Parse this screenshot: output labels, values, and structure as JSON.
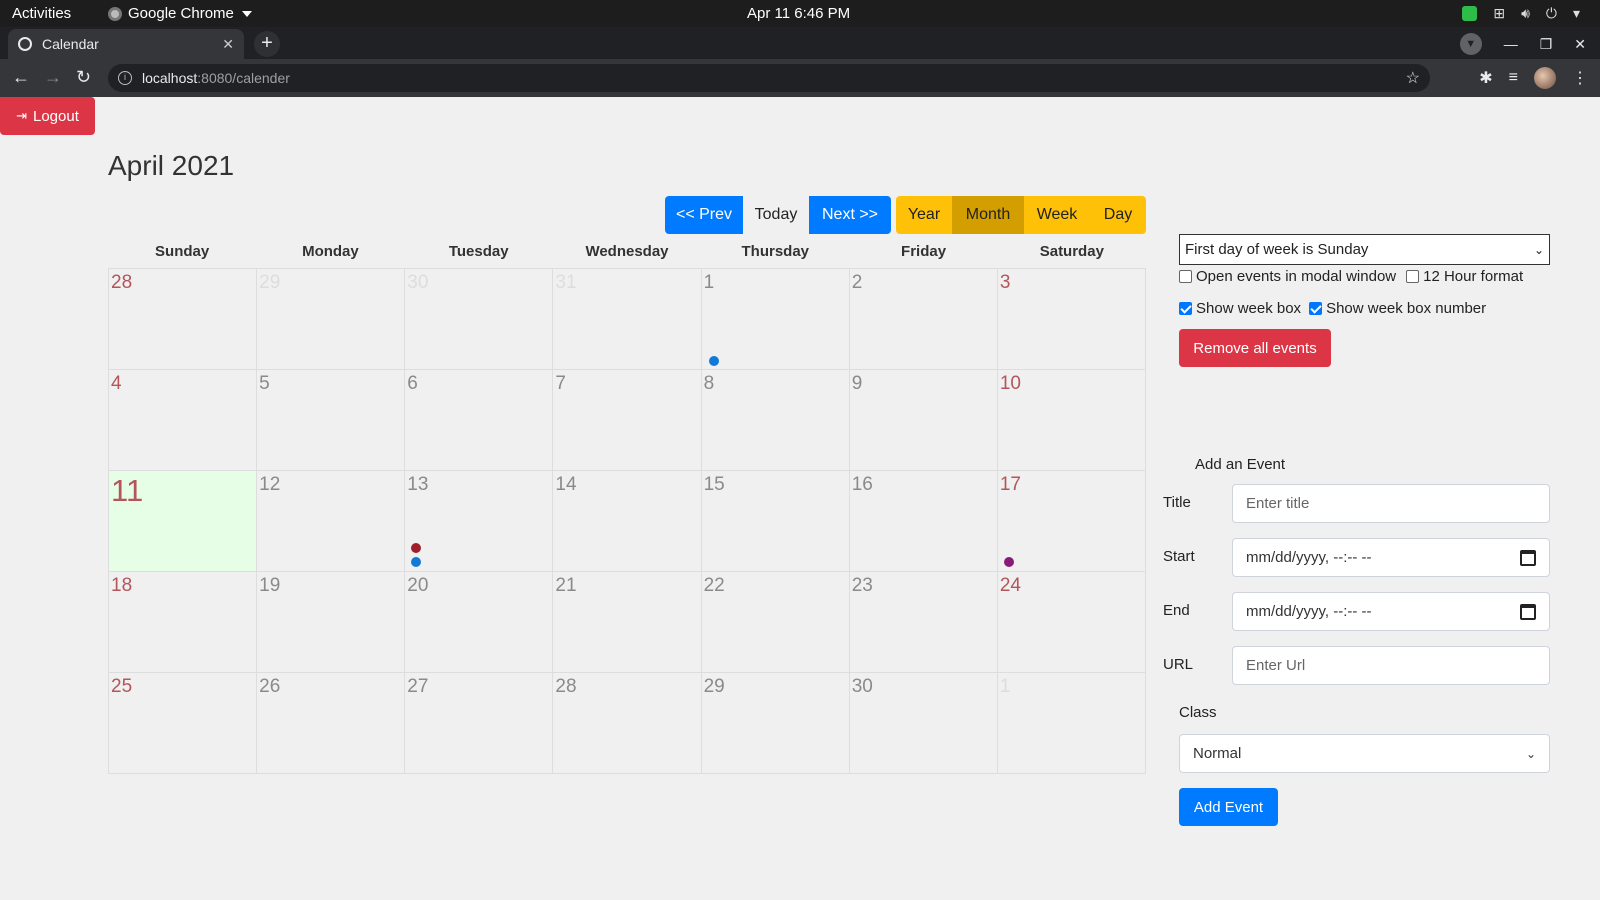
{
  "os": {
    "activities": "Activities",
    "app_name": "Google Chrome",
    "clock": "Apr 11  6:46 PM"
  },
  "browser": {
    "tab_title": "Calendar",
    "url_host": "localhost",
    "url_rest": ":8080/calender"
  },
  "page": {
    "logout_label": "Logout",
    "month_title": "April 2021",
    "nav": {
      "prev": "<< Prev",
      "today": "Today",
      "next": "Next >>"
    },
    "views": {
      "year": "Year",
      "month": "Month",
      "week": "Week",
      "day": "Day",
      "active": "Month"
    },
    "weekdays": [
      "Sunday",
      "Monday",
      "Tuesday",
      "Wednesday",
      "Thursday",
      "Friday",
      "Saturday"
    ],
    "weeks": [
      [
        "28",
        "29",
        "30",
        "31",
        "1",
        "2",
        "3"
      ],
      [
        "4",
        "5",
        "6",
        "7",
        "8",
        "9",
        "10"
      ],
      [
        "11",
        "12",
        "13",
        "14",
        "15",
        "16",
        "17"
      ],
      [
        "18",
        "19",
        "20",
        "21",
        "22",
        "23",
        "24"
      ],
      [
        "25",
        "26",
        "27",
        "28",
        "29",
        "30",
        "1"
      ]
    ],
    "today": "11",
    "event_colors": {
      "blue": "#1179d6",
      "red": "#a01e2a",
      "purple": "#8a1a7a"
    }
  },
  "settings": {
    "first_day_select": "First day of week is Sunday",
    "open_modal_label": "Open events in modal window",
    "open_modal_checked": false,
    "hour12_label": "12 Hour format",
    "hour12_checked": false,
    "show_week_box_label": "Show week box",
    "show_week_box_checked": true,
    "show_week_number_label": "Show week box number",
    "show_week_number_checked": true,
    "remove_all_label": "Remove all events"
  },
  "form": {
    "heading": "Add an Event",
    "title_label": "Title",
    "title_placeholder": "Enter title",
    "start_label": "Start",
    "start_placeholder": "mm/dd/yyyy, --:-- --",
    "end_label": "End",
    "end_placeholder": "mm/dd/yyyy, --:-- --",
    "url_label": "URL",
    "url_placeholder": "Enter Url",
    "class_label": "Class",
    "class_value": "Normal",
    "submit_label": "Add Event"
  }
}
